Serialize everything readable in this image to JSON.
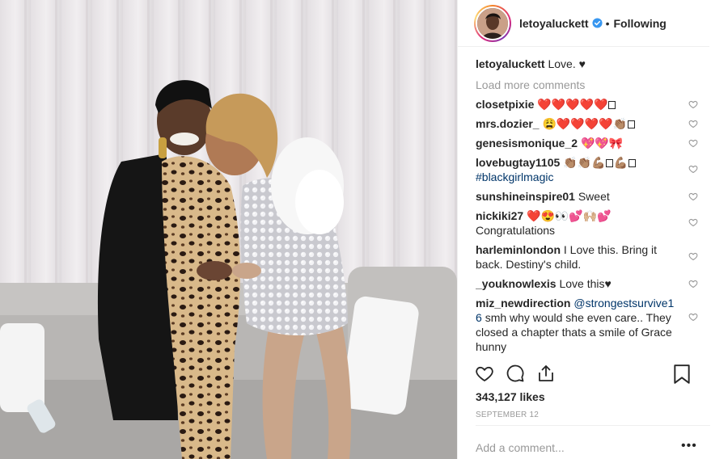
{
  "post": {
    "username": "letoyaluckett",
    "follow_status": "Following",
    "separator": "•",
    "caption_user": "letoyaluckett",
    "caption_text": " Love. ♥",
    "load_more": "Load more comments",
    "likes": "343,127 likes",
    "date": "SEPTEMBER 12",
    "add_comment_placeholder": "Add a comment...",
    "more_options": "•••"
  },
  "comments": [
    {
      "user": "closetpixie",
      "text": "❤️❤️❤️❤️❤️"
    },
    {
      "user": "mrs.dozier_",
      "text": "😩❤️❤️❤️❤️👏🏽"
    },
    {
      "user": "genesismonique_2",
      "text": "💖💖🎀"
    },
    {
      "user": "lovebugtay1105",
      "text": "👏🏽👏🏽💪🏽",
      "text2": "💪🏽",
      "tag": "#blackgirlmagic"
    },
    {
      "user": "sunshineinspire01",
      "text": "Sweet"
    },
    {
      "user": "nickiki27",
      "text": "❤️😍👀💕🙌🏼💕",
      "line2": "Congratulations"
    },
    {
      "user": "harleminlondon",
      "text": "I Love this. Bring it back. Destiny's child."
    },
    {
      "user": "_youknowlexis",
      "text": "Love this♥"
    },
    {
      "user": "miz_newdirection",
      "mention": "@strongestsurvive16",
      "text": "smh why would she even care.. They closed a chapter thats a smile of Grace hunny"
    }
  ],
  "icons": {
    "like": "heart-icon",
    "comment": "comment-icon",
    "share": "share-icon",
    "save": "bookmark-icon",
    "verified": "verified-badge-icon",
    "comment_like": "small-heart-icon"
  },
  "colors": {
    "verified": "#3897f0",
    "link": "#003569",
    "muted": "#999999",
    "text": "#262626"
  }
}
